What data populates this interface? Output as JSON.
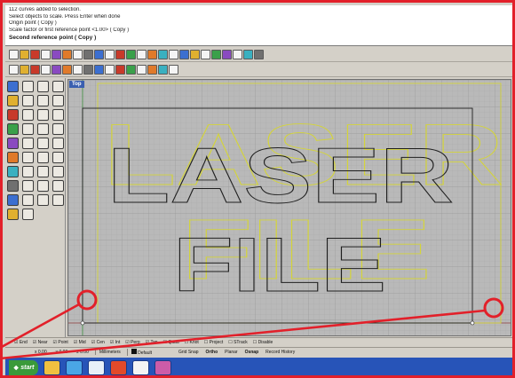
{
  "command_history": {
    "lines": [
      "112 curves added to selection.",
      "Select objects to scale. Press Enter when done",
      "Origin point ( Copy )",
      "Scale factor or first reference point <1.00> ( Copy )"
    ],
    "prompt": "Second reference point ( Copy )"
  },
  "viewport": {
    "label": "Top",
    "text_line_1": "LASER",
    "text_line_2": "FILE",
    "background_color": "#b9b9b9",
    "scaled_outline_color": "#1e1e1e",
    "original_outline_color": "#d4d43a"
  },
  "osnaps": [
    "End",
    "Near",
    "Point",
    "Mid",
    "Cen",
    "Int",
    "Perp",
    "Tan",
    "Quad",
    "Knot",
    "Project",
    "STrack",
    "Disable"
  ],
  "status_bar": {
    "coord_x": "x 0.00",
    "coord_y": "y 0.00",
    "coord_z": "z 0.00",
    "units": "Millimeters",
    "layer": "Default",
    "toggles": [
      "Grid Snap",
      "Ortho",
      "Planar",
      "Osnap",
      "Record History"
    ],
    "bold_toggles": [
      "Ortho",
      "Osnap"
    ]
  },
  "taskbar": {
    "start_label": "start",
    "apps": [
      "Explorer",
      "Folder",
      "Media Player",
      "Browser",
      "Rhino",
      "Mail"
    ],
    "app_colors": [
      "#f0c040",
      "#4aa6e6",
      "#e8f0f8",
      "#e24a2a",
      "#f4f4f4",
      "#cc5ca8"
    ]
  },
  "callouts": {
    "color": "#e2202a"
  },
  "icons": {
    "toolbar_top": [
      "new-icon",
      "open-icon",
      "save-icon",
      "print-icon",
      "cut-icon",
      "copy-icon",
      "paste-icon",
      "undo-icon",
      "pan-icon",
      "zoom-icon",
      "zoom-window-icon",
      "zoom-extents-icon",
      "zoom-selected-icon",
      "rotate-view-icon",
      "grid-icon",
      "layer-icon",
      "properties-icon",
      "osnap-icon",
      "shade-icon",
      "render-icon",
      "light-icon",
      "wireframe-icon",
      "sphere-icon",
      "help-icon"
    ],
    "toolbar_second": [
      "curve-icon",
      "line-icon",
      "polyline-icon",
      "arc-icon",
      "circle-icon",
      "rectangle-icon",
      "text-icon",
      "dimension-icon",
      "hatch-icon",
      "point-icon",
      "surface-icon",
      "solid-icon",
      "mesh-icon",
      "transform-icon",
      "array-icon",
      "boolean-icon"
    ],
    "palette": [
      "select-icon",
      "point-icon",
      "line-icon",
      "polyline-icon",
      "curve-icon",
      "circle-icon",
      "arc-icon",
      "ellipse-icon",
      "rectangle-icon",
      "polygon-icon",
      "text-icon",
      "fillet-icon",
      "surface-icon",
      "extrude-icon",
      "loft-icon",
      "revolve-icon",
      "sphere-icon",
      "box-icon",
      "cylinder-icon",
      "boolean-icon",
      "move-icon",
      "copy-icon",
      "rotate-icon",
      "scale-icon",
      "mirror-icon",
      "array-icon",
      "trim-icon",
      "split-icon",
      "join-icon",
      "explode-icon",
      "offset-icon",
      "dimension-icon",
      "osnap-icon",
      "layer-icon",
      "properties-icon",
      "analyze-icon",
      "render-icon",
      "light-icon"
    ]
  }
}
